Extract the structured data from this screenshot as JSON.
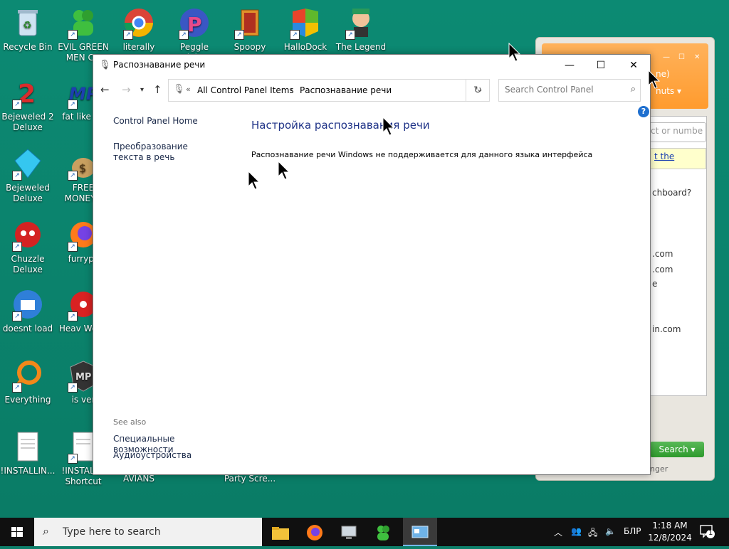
{
  "desktop": {
    "icons": [
      {
        "label": "Recycle Bin"
      },
      {
        "label": "EVIL GREEN MEN CO"
      },
      {
        "label": "literally"
      },
      {
        "label": "Peggle Nights"
      },
      {
        "label": "Spoopy"
      },
      {
        "label": "HalloDock"
      },
      {
        "label": "The Legend"
      },
      {
        "label": "Bejeweled 2 Deluxe"
      },
      {
        "label": "fat like da"
      },
      {
        "label": "Bejeweled Deluxe"
      },
      {
        "label": "FREE MONEY..."
      },
      {
        "label": "Chuzzle Deluxe"
      },
      {
        "label": "furrypc"
      },
      {
        "label": "doesnt load"
      },
      {
        "label": "Heav Weap"
      },
      {
        "label": "Everything"
      },
      {
        "label": "is ver"
      },
      {
        "label": "!INSTALLIN..."
      },
      {
        "label": "!INSTALL - Shortcut"
      },
      {
        "label": "AVIANS"
      },
      {
        "label": "Party Scre..."
      }
    ]
  },
  "bg_window": {
    "frag_title": "ne)",
    "frag_menu": "nuts",
    "search_placeholder": "ct or numbe",
    "note_link": "t the",
    "question": "chboard?",
    "lines": [
      ".com",
      ".com",
      "e",
      "in.com"
    ],
    "search_button": "Search",
    "footer": "nger"
  },
  "window": {
    "title": "Распознавание речи",
    "minimize": "—",
    "maximize": "☐",
    "close": "✕",
    "breadcrumb_root": "All Control Panel Items",
    "breadcrumb_current": "Распознавание речи",
    "search_placeholder": "Search Control Panel",
    "help": "?"
  },
  "left_pane": {
    "home": "Control Panel Home",
    "tts": "Преобразование текста в речь",
    "see_also": "See also",
    "accessibility": "Специальные возможности",
    "audio": "Аудиоустройства"
  },
  "main": {
    "heading": "Настройка распознавания речи",
    "message": "Распознавание речи Windows не поддерживается для данного языка интерфейса"
  },
  "taskbar": {
    "search_placeholder": "Type here to search",
    "language": "БЛР",
    "time": "1:18 AM",
    "date": "12/8/2024",
    "notifications": "1"
  },
  "colors": {
    "desktop": "#0c8a73",
    "heading": "#1e3287",
    "taskbar": "#101010"
  }
}
